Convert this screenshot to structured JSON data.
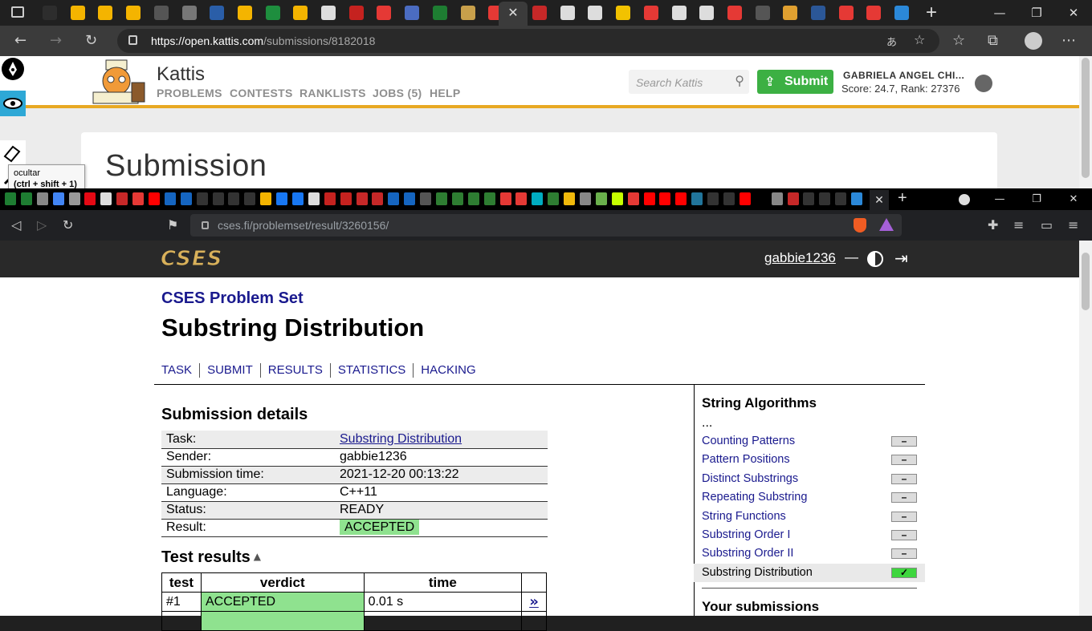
{
  "edge": {
    "url_host": "https://open.kattis.com",
    "url_path": "/submissions/8182018",
    "active_tab_close": "✕",
    "tab_colors": [
      "#2d2d2d",
      "#f4b400",
      "#f4b400",
      "#f4b400",
      "#555",
      "#777",
      "#2a5ea8",
      "#f4b400",
      "#1e8e3e",
      "#f4b400",
      "#ddd",
      "#c5221f",
      "#e53935",
      "#4b6cc1",
      "#1e7d32",
      "#c8a04b",
      "#e53935",
      "#c62828",
      "#ddd",
      "#ddd",
      "#f2c200",
      "#e53935",
      "#ddd",
      "#ddd",
      "#e53935",
      "#555",
      "#e0a030",
      "#2b5797",
      "#e53935",
      "#e53935",
      "#2b88d8"
    ],
    "new_tab": "+",
    "window_controls": [
      "—",
      "❐",
      "✕"
    ]
  },
  "kattis": {
    "brand": "Kattis",
    "nav": [
      "PROBLEMS",
      "CONTESTS",
      "RANKLISTS",
      "JOBS (5)",
      "HELP"
    ],
    "search_placeholder": "Search Kattis",
    "submit_label": "Submit",
    "user_name": "GABRIELA ANGEL CHI...",
    "user_score": "Score: 24.7, Rank: 27376",
    "page_title": "Submission",
    "accent_color": "#e8a923"
  },
  "annotation": {
    "tooltip_line1": "ocultar",
    "tooltip_line2": "(ctrl + shift + 1)"
  },
  "brave": {
    "url_host": "cses.fi",
    "url_path": "/problemset/result/3260156/",
    "tab_colors": [
      "#1e7d32",
      "#1e7d32",
      "#888",
      "#4285f4",
      "#999",
      "#e50914",
      "#ddd",
      "#c62828",
      "#e53935",
      "#ff0000",
      "#1565c0",
      "#1565c0",
      "#333",
      "#333",
      "#333",
      "#333",
      "#f4b400",
      "#1877f2",
      "#1877f2",
      "#ddd",
      "#c5221f",
      "#c5221f",
      "#c62828",
      "#c62828",
      "#1565c0",
      "#1565c0",
      "#555",
      "#2e7d32",
      "#2e7d32",
      "#2e7d32",
      "#2e7d32",
      "#e53935",
      "#e53935",
      "#00acc1",
      "#2e7d32",
      "#f0b90b",
      "#888",
      "#6ab04c",
      "#c6ff00",
      "#e53935",
      "#ff0000",
      "#ff0000",
      "#ff0000",
      "#21759b",
      "#333",
      "#333",
      "#ff0000",
      "#000",
      "#888",
      "#c62828",
      "#333",
      "#333",
      "#333",
      "#2b88d8"
    ],
    "active_tab_close": "✕",
    "new_tab": "+",
    "window_controls": [
      "—",
      "❐",
      "✕"
    ]
  },
  "cses": {
    "logo": "CSES",
    "username": "gabbie1236",
    "dash": "—",
    "problem_set": "CSES Problem Set",
    "title": "Substring Distribution",
    "tabs": [
      "TASK",
      "SUBMIT",
      "RESULTS",
      "STATISTICS",
      "HACKING"
    ],
    "details_heading": "Submission details",
    "details": [
      {
        "label": "Task:",
        "value": "Substring Distribution"
      },
      {
        "label": "Sender:",
        "value": "gabbie1236"
      },
      {
        "label": "Submission time:",
        "value": "2021-12-20 00:13:22"
      },
      {
        "label": "Language:",
        "value": "C++11"
      },
      {
        "label": "Status:",
        "value": "READY"
      },
      {
        "label": "Result:",
        "value": "ACCEPTED"
      }
    ],
    "results_heading": "Test results",
    "results_columns": [
      "test",
      "verdict",
      "time"
    ],
    "results_rows": [
      {
        "test": "#1",
        "verdict": "ACCEPTED",
        "time": "0.01 s",
        "link": "»"
      }
    ],
    "sidebar_heading": "String Algorithms",
    "sidebar_dots": "...",
    "sidebar_items": [
      {
        "label": "Counting Patterns",
        "status": "–"
      },
      {
        "label": "Pattern Positions",
        "status": "–"
      },
      {
        "label": "Distinct Substrings",
        "status": "–"
      },
      {
        "label": "Repeating Substring",
        "status": "–"
      },
      {
        "label": "String Functions",
        "status": "–"
      },
      {
        "label": "Substring Order I",
        "status": "–"
      },
      {
        "label": "Substring Order II",
        "status": "–"
      },
      {
        "label": "Substring Distribution",
        "status": "✓"
      }
    ],
    "your_submissions": "Your submissions",
    "accept_color": "#8fe28f"
  }
}
